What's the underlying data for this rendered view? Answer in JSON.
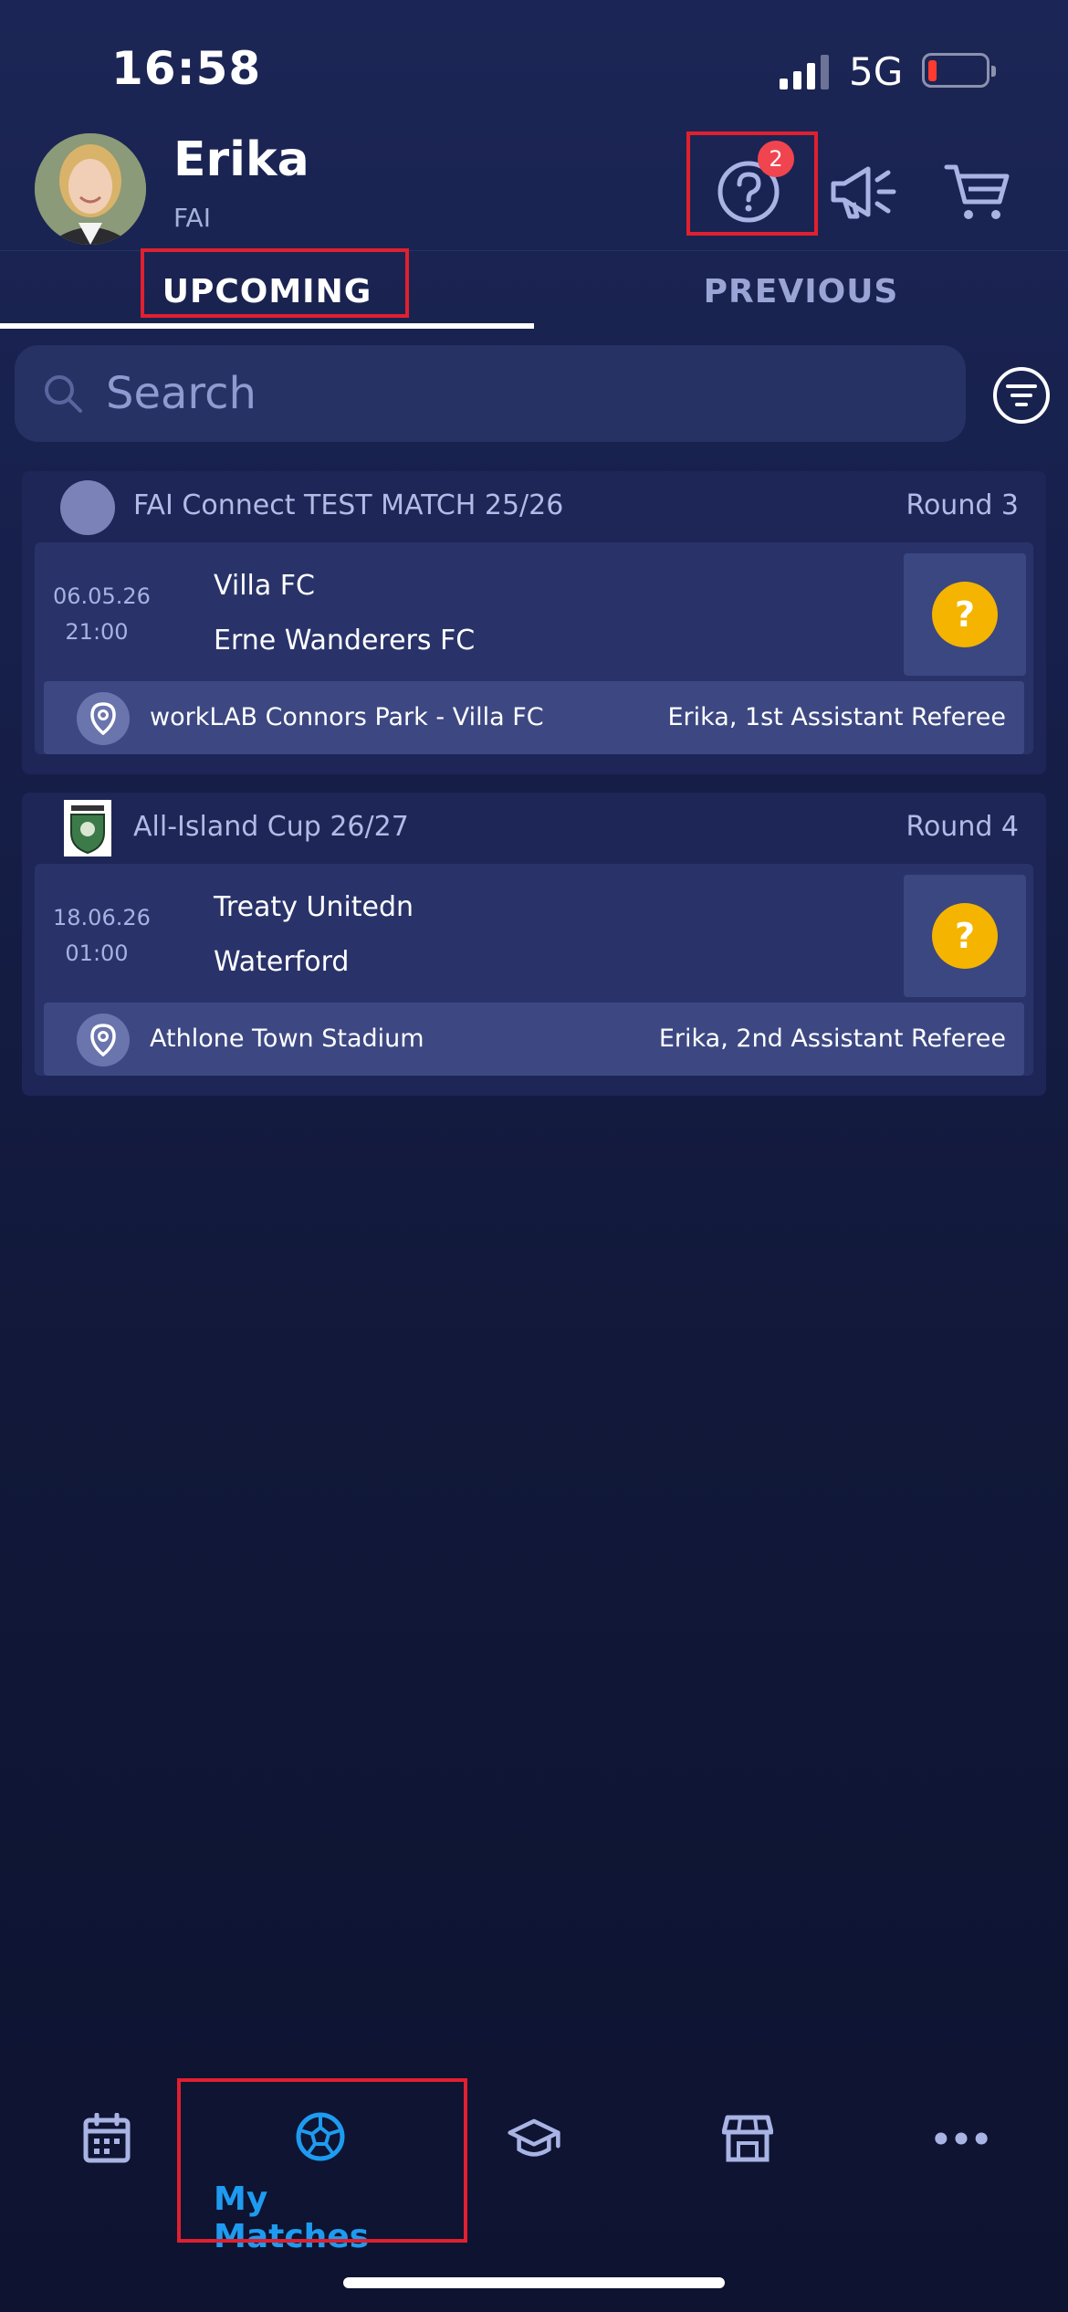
{
  "status_bar": {
    "time": "16:58",
    "network": "5G"
  },
  "profile": {
    "name": "Erika",
    "org": "FAI"
  },
  "header": {
    "help_badge": "2"
  },
  "tabs": [
    {
      "label": "UPCOMING",
      "active": true
    },
    {
      "label": "PREVIOUS",
      "active": false
    }
  ],
  "search": {
    "placeholder": "Search",
    "value": ""
  },
  "matches": [
    {
      "competition": "FAI Connect TEST MATCH 25/26",
      "round": "Round 3",
      "date": "06.05.26",
      "time": "21:00",
      "home_team": "Villa FC",
      "away_team": "Erne Wanderers FC",
      "status_symbol": "?",
      "venue": "workLAB Connors Park - Villa FC",
      "role": "Erika, 1st Assistant Referee"
    },
    {
      "competition": "All-Island Cup 26/27",
      "round": "Round 4",
      "date": "18.06.26",
      "time": "01:00",
      "home_team": "Treaty Unitedn",
      "away_team": "Waterford",
      "status_symbol": "?",
      "venue": "Athlone Town Stadium",
      "role": "Erika, 2nd Assistant Referee"
    }
  ],
  "nav": {
    "items": [
      {
        "icon": "calendar-icon",
        "label": ""
      },
      {
        "icon": "soccer-ball-icon",
        "label": "My Matches",
        "active": true
      },
      {
        "icon": "graduation-cap-icon",
        "label": ""
      },
      {
        "icon": "store-icon",
        "label": ""
      },
      {
        "icon": "more-icon",
        "label": ""
      }
    ]
  },
  "colors": {
    "accent": "#1e9bf0",
    "warning": "#f4b400",
    "badge": "#f0444f",
    "highlight_box": "#e0202f",
    "background": "#141c45"
  }
}
